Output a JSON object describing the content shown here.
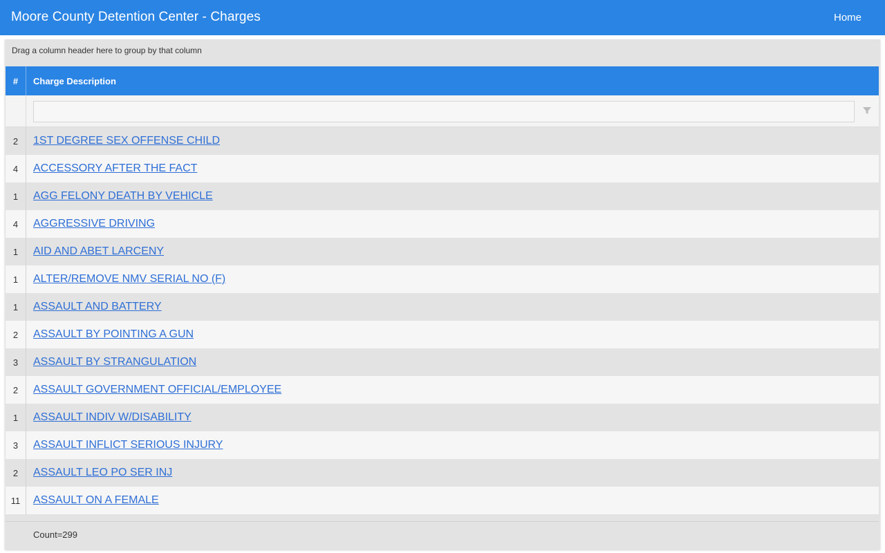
{
  "app": {
    "title": "Moore County Detention Center - Charges",
    "nav_home": "Home"
  },
  "grid": {
    "group_panel_text": "Drag a column header here to group by that column",
    "columns": {
      "num": "#",
      "desc": "Charge Description"
    },
    "filter": {
      "value": "",
      "placeholder": ""
    },
    "rows": [
      {
        "count": "2",
        "charge": "1ST DEGREE SEX OFFENSE CHILD"
      },
      {
        "count": "4",
        "charge": "ACCESSORY AFTER THE FACT"
      },
      {
        "count": "1",
        "charge": "AGG FELONY DEATH BY VEHICLE"
      },
      {
        "count": "4",
        "charge": "AGGRESSIVE DRIVING"
      },
      {
        "count": "1",
        "charge": "AID AND ABET LARCENY"
      },
      {
        "count": "1",
        "charge": "ALTER/REMOVE NMV SERIAL NO (F)"
      },
      {
        "count": "1",
        "charge": "ASSAULT AND BATTERY"
      },
      {
        "count": "2",
        "charge": "ASSAULT BY POINTING A GUN"
      },
      {
        "count": "3",
        "charge": "ASSAULT BY STRANGULATION"
      },
      {
        "count": "2",
        "charge": "ASSAULT GOVERNMENT OFFICIAL/EMPLOYEE"
      },
      {
        "count": "1",
        "charge": "ASSAULT INDIV W/DISABILITY"
      },
      {
        "count": "3",
        "charge": "ASSAULT INFLICT SERIOUS INJURY"
      },
      {
        "count": "2",
        "charge": "ASSAULT LEO PO SER INJ"
      },
      {
        "count": "11",
        "charge": "ASSAULT ON A FEMALE"
      }
    ],
    "footer_summary": "Count=299"
  },
  "colors": {
    "header_blue": "#2a84e3",
    "link_blue": "#2f6fd6",
    "row_odd": "#e3e3e3",
    "row_even": "#f6f6f6"
  },
  "icons": {
    "filter": "filter-icon"
  }
}
